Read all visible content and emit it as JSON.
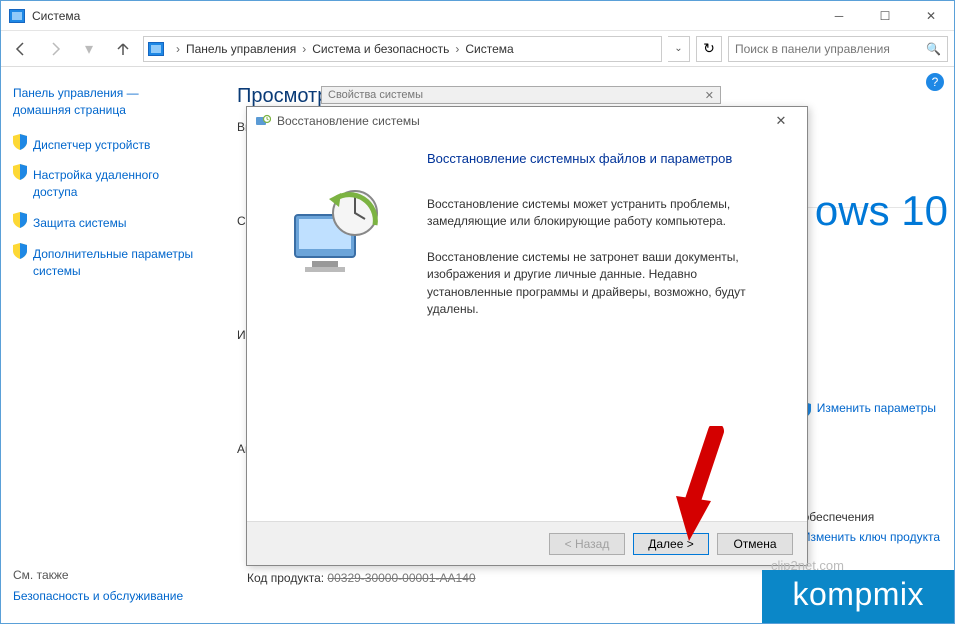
{
  "window": {
    "title": "Система"
  },
  "toolbar": {
    "crumbs": [
      "Панель управления",
      "Система и безопасность",
      "Система"
    ],
    "search_placeholder": "Поиск в панели управления"
  },
  "sidebar": {
    "home": "Панель управления — домашняя страница",
    "items": [
      "Диспетчер устройств",
      "Настройка удаленного доступа",
      "Защита системы",
      "Дополнительные параметры системы"
    ],
    "see_also_label": "См. также",
    "see_also": "Безопасность и обслуживание"
  },
  "main": {
    "heading": "Просмотр ос",
    "rows": {
      "r1": "Вып",
      "r2": "Сис",
      "r3": "Имя",
      "r4": "Акти"
    },
    "product_prefix": "Код продукта:",
    "product_code": "00329-30000-00001-AA140",
    "windows10": "ows 10",
    "change_params": "Изменить параметры",
    "activation_line": "ого обеспечения",
    "change_key": "Изменить ключ продукта"
  },
  "props_dialog": {
    "title": "Свойства системы"
  },
  "restore_dialog": {
    "title": "Восстановление системы",
    "heading": "Восстановление системных файлов и параметров",
    "para1": "Восстановление системы может устранить проблемы, замедляющие или блокирующие работу компьютера.",
    "para2": "Восстановление системы не затронет ваши документы, изображения и другие личные данные. Недавно установленные программы и драйверы, возможно, будут удалены.",
    "back": "< Назад",
    "next": "Далее >",
    "cancel": "Отмена"
  },
  "watermark": "kompmix",
  "watermark_sub": "clip2net.com"
}
